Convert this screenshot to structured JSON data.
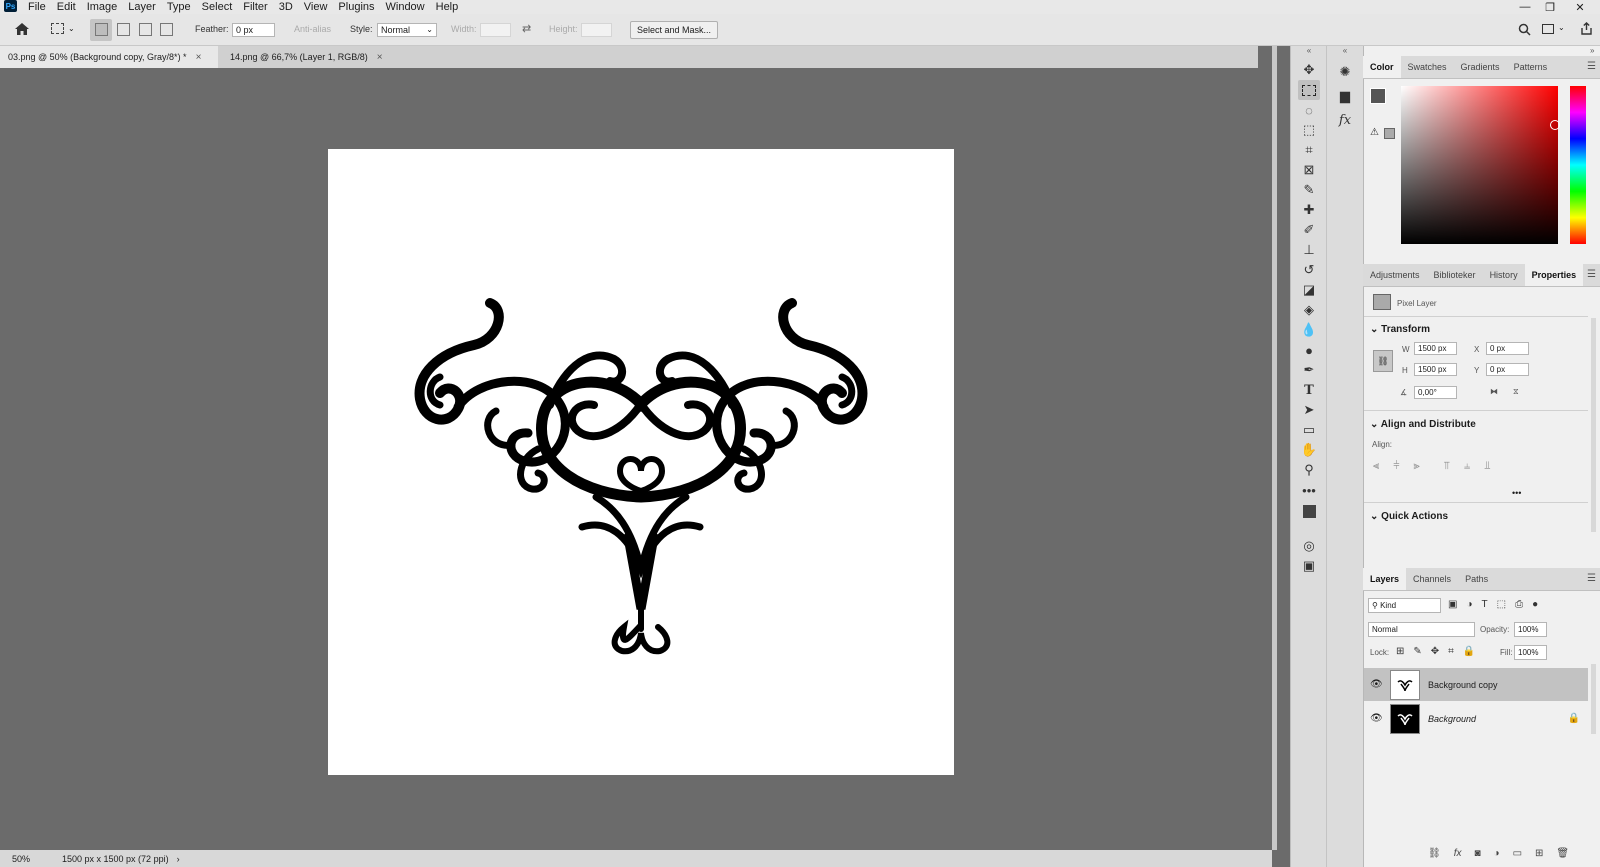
{
  "app": {
    "logo": "Ps"
  },
  "menu": [
    "File",
    "Edit",
    "Image",
    "Layer",
    "Type",
    "Select",
    "Filter",
    "3D",
    "View",
    "Plugins",
    "Window",
    "Help"
  ],
  "window_controls": [
    "—",
    "❐",
    "✕"
  ],
  "options": {
    "feather_label": "Feather:",
    "feather_value": "0 px",
    "antialias_label": "Anti-alias",
    "style_label": "Style:",
    "style_value": "Normal",
    "width_label": "Width:",
    "height_label": "Height:",
    "select_mask_label": "Select and Mask..."
  },
  "tabs": [
    {
      "label": "03.png @ 50% (Background copy, Gray/8*) *",
      "active": true
    },
    {
      "label": "14.png @ 66,7% (Layer 1, RGB/8)",
      "active": false
    }
  ],
  "status": {
    "zoom": "50%",
    "doc_info": "1500 px x 1500 px (72 ppi)",
    "arrow": "›"
  },
  "color_tabs": [
    "Color",
    "Swatches",
    "Gradients",
    "Patterns"
  ],
  "props_tabs": [
    "Adjustments",
    "Biblioteker",
    "History",
    "Properties"
  ],
  "properties": {
    "layer_type": "Pixel Layer",
    "transform_title": "Transform",
    "w_label": "W",
    "w_value": "1500 px",
    "h_label": "H",
    "h_value": "1500 px",
    "x_label": "X",
    "x_value": "0 px",
    "y_label": "Y",
    "y_value": "0 px",
    "angle_value": "0,00°",
    "align_title": "Align and Distribute",
    "align_label": "Align:",
    "more": "•••",
    "quick_title": "Quick Actions"
  },
  "layers_tabs": [
    "Layers",
    "Channels",
    "Paths"
  ],
  "layers_panel": {
    "kind": "Kind",
    "blend": "Normal",
    "opacity_label": "Opacity:",
    "opacity_value": "100%",
    "lock_label": "Lock:",
    "fill_label": "Fill:",
    "fill_value": "100%",
    "layers": [
      {
        "name": "Background copy",
        "selected": true
      },
      {
        "name": "Background",
        "selected": false
      }
    ]
  },
  "colors": {
    "accent": "#31a8ff",
    "canvas_bg": "#6b6b6b",
    "selected_layer": "#c2c2c2"
  }
}
